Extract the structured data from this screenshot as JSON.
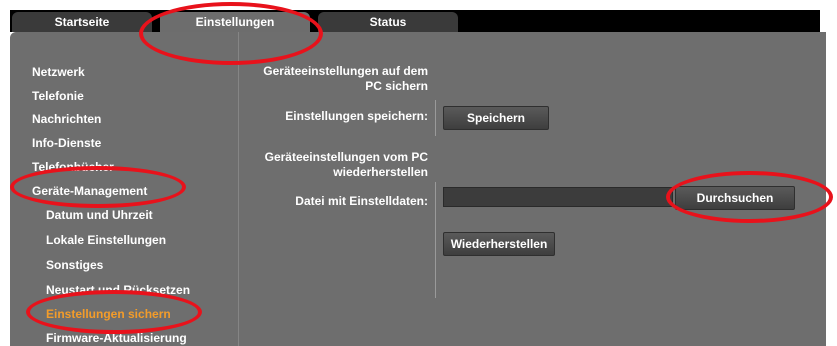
{
  "tabs": [
    {
      "label": "Startseite"
    },
    {
      "label": "Einstellungen"
    },
    {
      "label": "Status"
    }
  ],
  "sidebar": {
    "items": [
      {
        "label": "Netzwerk"
      },
      {
        "label": "Telefonie"
      },
      {
        "label": "Nachrichten"
      },
      {
        "label": "Info-Dienste"
      },
      {
        "label": "Telefonbücher"
      },
      {
        "label": "Geräte-Management"
      },
      {
        "label": "Datum und Uhrzeit"
      },
      {
        "label": "Lokale Einstellungen"
      },
      {
        "label": "Sonstiges"
      },
      {
        "label": "Neustart und Rücksetzen"
      },
      {
        "label": "Einstellungen sichern"
      },
      {
        "label": "Firmware-Aktualisierung"
      }
    ]
  },
  "backup": {
    "heading": "Geräteeinstellungen auf dem PC sichern",
    "save_label": "Einstellungen speichern:",
    "save_button": "Speichern"
  },
  "restore": {
    "heading": "Geräteeinstellungen vom PC wiederherstellen",
    "file_label": "Datei mit Einstelldaten:",
    "browse_button": "Durchsuchen",
    "restore_button": "Wiederherstellen"
  },
  "colors": {
    "panel": "#6e6e6e",
    "tabbar": "#000000",
    "active_nav": "#f39c2a",
    "annotation": "#e8121b"
  }
}
